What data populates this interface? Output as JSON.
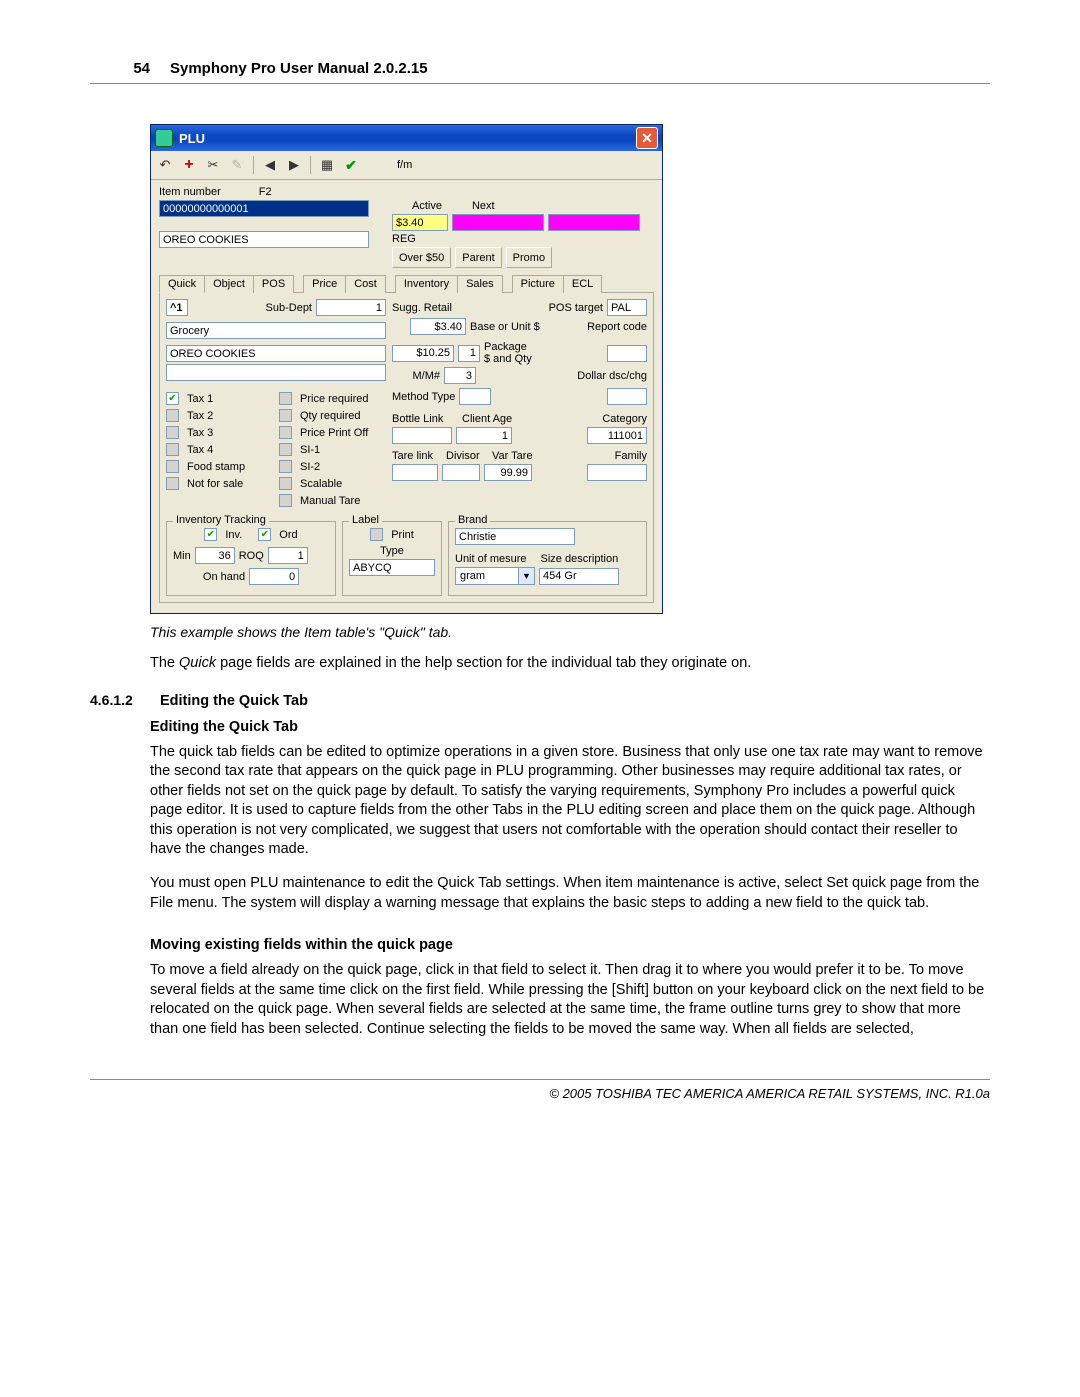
{
  "page_number": "54",
  "header_title": "Symphony Pro User Manual  2.0.2.15",
  "window": {
    "title": "PLU",
    "toolbar_fm": "f/m",
    "item_number_label": "Item number",
    "item_number_hotkey": "F2",
    "item_number_value": "00000000000001",
    "desc_value": "OREO COOKIES",
    "active_label": "Active",
    "next_label": "Next",
    "price_badge": "$3.40",
    "reg_label": "REG",
    "buttons": {
      "over50": "Over $50",
      "parent": "Parent",
      "promo": "Promo"
    },
    "tabs": [
      "Quick",
      "Object",
      "POS",
      "Price",
      "Cost",
      "Inventory",
      "Sales",
      "Picture",
      "ECL"
    ],
    "active_tab": "Quick",
    "quick": {
      "caret": "^1",
      "subdept_label": "Sub-Dept",
      "subdept_value": "1",
      "subdept_name": "Grocery",
      "desc2": "OREO COOKIES",
      "sugg_retail_label": "Sugg. Retail",
      "pos_target_label": "POS target",
      "pos_target_value": "PAL",
      "base_price": "$3.40",
      "base_label": "Base or Unit $",
      "report_code_label": "Report code",
      "pkg_price": "$10.25",
      "pkg_qty": "1",
      "pkg_label": "Package\n$ and Qty",
      "mm_label": "M/M#",
      "mm_value": "3",
      "dollar_dsc_label": "Dollar dsc/chg",
      "chk_left": [
        "Tax 1",
        "Tax 2",
        "Tax 3",
        "Tax 4",
        "Food stamp",
        "Not for sale"
      ],
      "chk_right": [
        "Price required",
        "Qty required",
        "Price Print  Off",
        "SI-1",
        "SI-2",
        "Scalable",
        "Manual Tare"
      ],
      "method_type_label": "Method Type",
      "bottle_link_label": "Bottle Link",
      "client_age_label": "Client Age",
      "client_age_value": "1",
      "category_label": "Category",
      "category_value": "111001",
      "tare_link_label": "Tare link",
      "divisor_label": "Divisor",
      "var_tare_label": "Var Tare",
      "var_tare_value": "99.99",
      "family_label": "Family",
      "inv_tracking_legend": "Inventory Tracking",
      "inv_chk": "Inv.",
      "ord_chk": "Ord",
      "min_label": "Min",
      "min_value": "36",
      "roq_label": "ROQ",
      "roq_value": "1",
      "onhand_label": "On hand",
      "onhand_value": "0",
      "label_legend": "Label",
      "print_chk": "Print",
      "type_label": "Type",
      "type_value": "ABYCQ",
      "brand_legend": "Brand",
      "brand_value": "Christie",
      "uom_label": "Unit of mesure",
      "uom_value": "gram",
      "size_desc_label": "Size description",
      "size_desc_value": "454 Gr"
    }
  },
  "caption": "This example shows the Item table's \"Quick\" tab.",
  "para_intro": "The Quick page fields are explained in the help section for the individual tab they originate on.",
  "section_number": "4.6.1.2",
  "section_title": "Editing the Quick Tab",
  "sub_title": "Editing the Quick Tab",
  "para1": " The quick tab fields can be edited to optimize operations in a given store. Business that only use one tax rate may want to remove the second tax rate that appears on the quick page in PLU programming. Other businesses may require additional tax rates, or other fields not set on the quick page by default. To satisfy the varying requirements, Symphony Pro includes a powerful quick page editor. It is used to capture fields from the other Tabs in the PLU editing screen and place them on the quick page. Although this operation is not very complicated, we suggest that users not comfortable with the operation should contact their reseller to have the changes made.",
  "para2": " You must open PLU maintenance to edit the Quick Tab settings. When item maintenance is active, select Set quick page from the File menu. The system will display a warning message that explains the basic steps to adding a new field to the quick tab.",
  "subhead2": "Moving existing fields within the quick page",
  "para3": " To move a field already on the quick page, click in that field to select it. Then drag it to where you would prefer it to be. To move several fields at the same time click on the first field. While pressing the [Shift] button on your keyboard click on the next field to be relocated on the quick page. When several fields are selected at the same time, the frame outline turns grey to show that more than one field has been selected. Continue selecting the fields to be moved the same way. When all fields are selected,",
  "footer": "© 2005 TOSHIBA TEC AMERICA AMERICA RETAIL SYSTEMS, INC.   R1.0a"
}
